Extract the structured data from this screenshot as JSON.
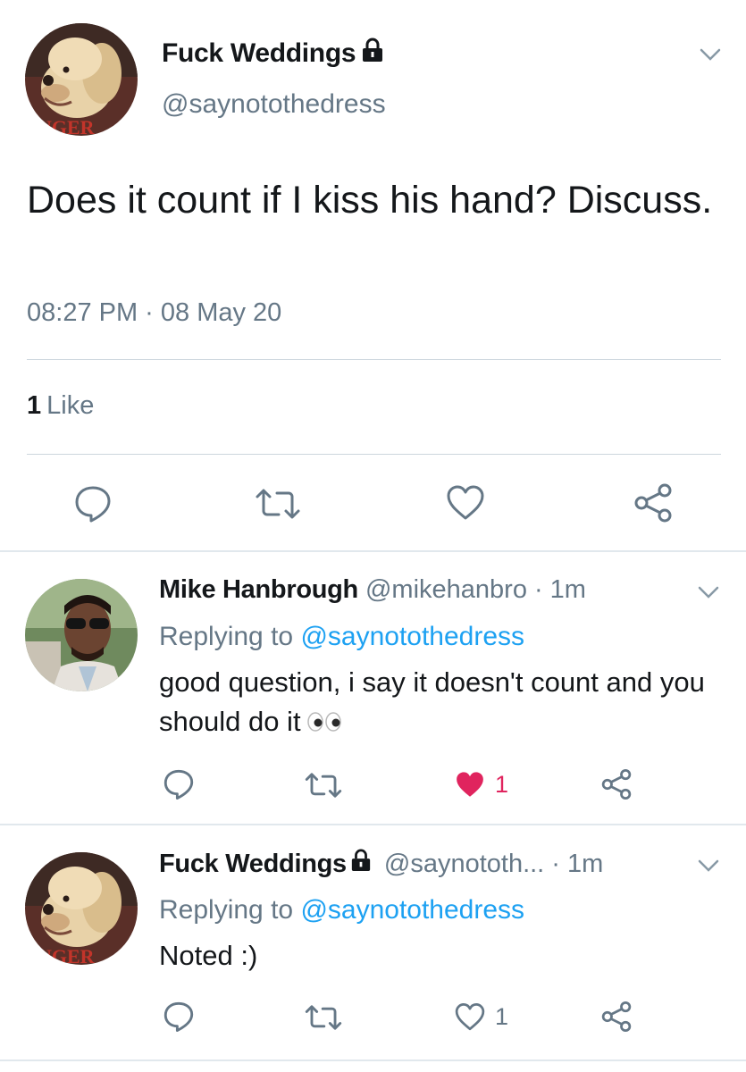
{
  "main_tweet": {
    "display_name": "Fuck Weddings",
    "handle": "@saynotothedress",
    "text": "Does it count if I kiss his hand? Discuss.",
    "timestamp": "08:27 PM · 08 May 20",
    "like_count": "1",
    "like_label": "Like",
    "avatar_banner": "NGER",
    "icons": [
      "reply-icon",
      "retweet-icon",
      "like-icon",
      "share-icon",
      "lock-icon",
      "chevron-down-icon"
    ]
  },
  "replies": [
    {
      "display_name": "Mike Hanbrough",
      "handle": "@mikehanbro",
      "time": "· 1m",
      "replying_prefix": "Replying to",
      "replying_to": "@saynotothedress",
      "text": "good question, i say it doesn't count and you should do it",
      "emoji": "eyes",
      "like_count": "1",
      "liked": true,
      "locked": false
    },
    {
      "display_name": "Fuck Weddings",
      "handle": "@saynototh...",
      "time": "· 1m",
      "replying_prefix": "Replying to",
      "replying_to": "@saynotothedress",
      "text": "Noted :)",
      "like_count": "1",
      "liked": false,
      "locked": true,
      "avatar_banner": "NGER"
    }
  ],
  "colors": {
    "text": "#14171a",
    "secondary": "#657786",
    "link": "#1da1f2",
    "like_active": "#e0245e",
    "divider": "#e1e8ed"
  }
}
